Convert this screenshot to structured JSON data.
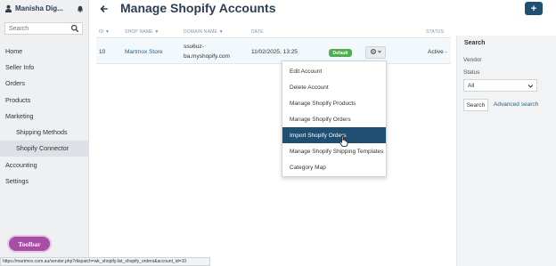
{
  "sidebar": {
    "user_name": "Manisha Dig...",
    "search_placeholder": "Search",
    "items": [
      {
        "label": "Home"
      },
      {
        "label": "Seller Info"
      },
      {
        "label": "Orders"
      },
      {
        "label": "Products"
      },
      {
        "label": "Marketing"
      },
      {
        "label": "Shipping Methods"
      },
      {
        "label": "Shopify Connector"
      },
      {
        "label": "Accounting"
      },
      {
        "label": "Settings"
      }
    ],
    "toolbar_label": "Toolbar"
  },
  "header": {
    "title": "Manage Shopify Accounts",
    "add_label": "+"
  },
  "table": {
    "columns": [
      "ID",
      "SHOP NAME",
      "DOMAIN NAME",
      "DATE",
      "STATUS"
    ],
    "sort_marker": "▼",
    "row": {
      "id": "10",
      "shop_name": "Martmox Store",
      "domain_line1": "ssu6uz-",
      "domain_line2": "ba.myshopify.com",
      "date": "11/02/2025, 13:25",
      "badge": "Default",
      "status": "Active -"
    }
  },
  "actions_menu": {
    "items": [
      "Edit Account",
      "Delete Account",
      "Manage Shopify Products",
      "Manage Shopify Orders",
      "Import Shopify Orders",
      "Manage Shopify Shipping Templates",
      "Category Map"
    ],
    "highlighted": "Import Shopify Orders"
  },
  "search_panel": {
    "title": "Search",
    "vendor_label": "Vendor",
    "status_label": "Status",
    "status_value": "All",
    "search_button": "Search",
    "advanced_link": "Advanced search"
  },
  "status_url": "https://martmox.com.au/vendor.php?dispatch=wk_shopify.list_shopify_orders&account_id=10",
  "colors": {
    "primary": "#1f4f73",
    "badge_green": "#4cae4c",
    "toolbar_purple": "#a64ea3"
  }
}
